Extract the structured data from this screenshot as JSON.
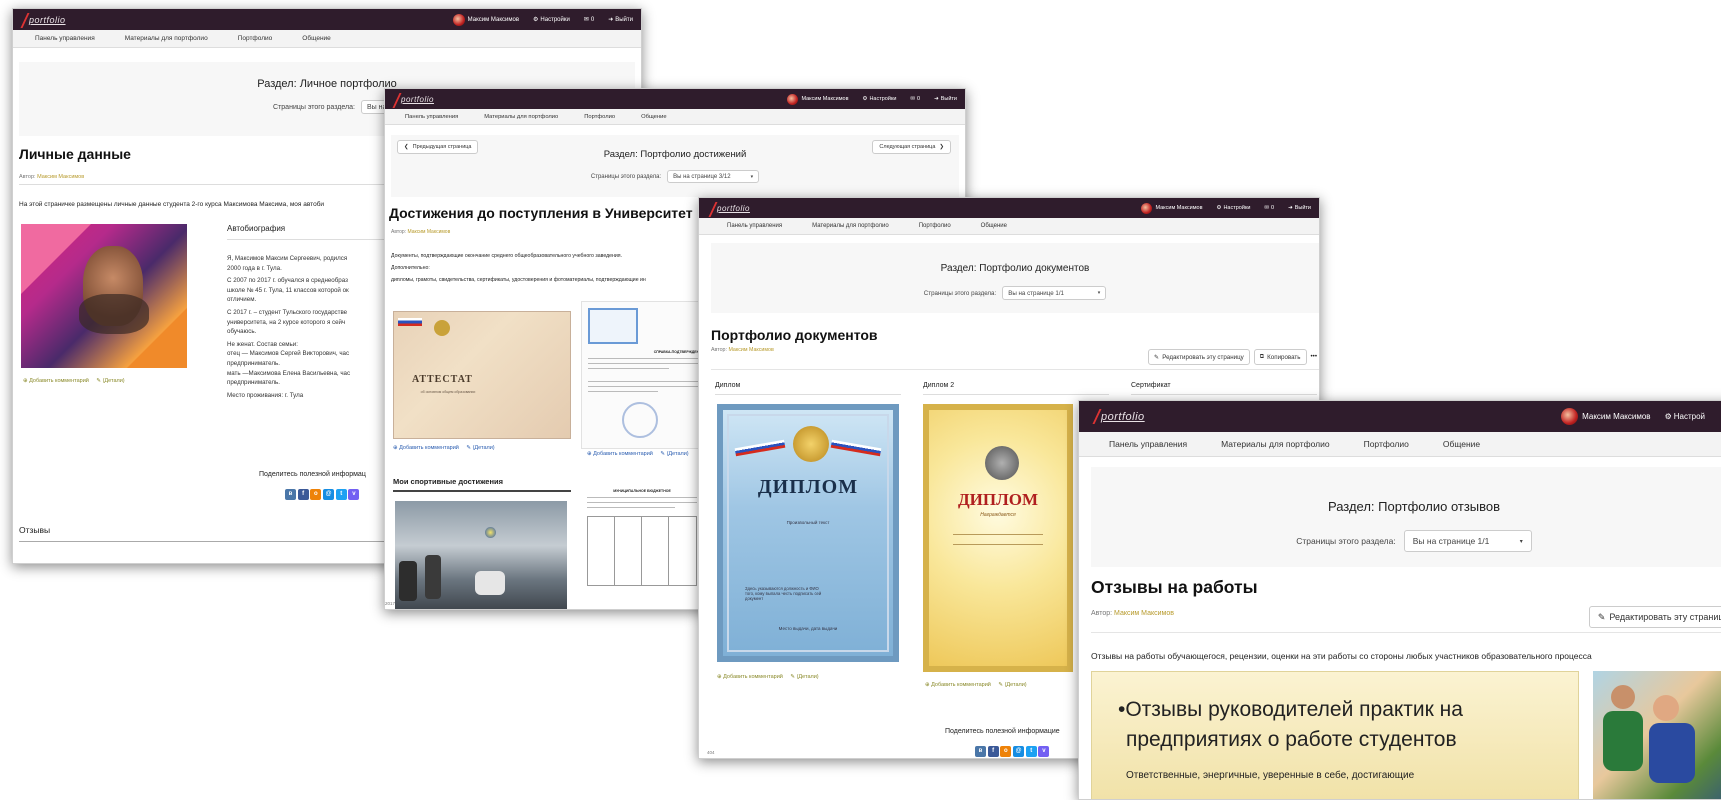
{
  "common": {
    "user_name": "Максим Максимов",
    "settings": "Настройки",
    "mail_count": "0",
    "logout": "Выйти",
    "logo_text": "portfolio",
    "menu": [
      "Панель управления",
      "Материалы для портфолио",
      "Портфолио",
      "Общение"
    ],
    "pages_label": "Страницы этого раздела:",
    "add_comment": "Добавить комментарий",
    "details": "(Детали)",
    "author_label": "Автор:",
    "share_text": "Поделитесь полезной информацией",
    "edit_page": "Редактировать эту страницу",
    "copy": "Копировать",
    "more": "•••"
  },
  "w1": {
    "section": "Раздел: Личное портфолио",
    "page_select": "Вы на страни",
    "title": "Личные данные",
    "author": "Максим Максимов",
    "intro": "На этой страничке размещены личные данные студента 2-го курса Максимова Максима, моя автоби",
    "bio_heading": "Автобиография",
    "bio_lines": [
      "Я, Максимов Максим Сергеевич, родился",
      "2000 года в г. Тула.",
      "С 2007 по 2017 г. обучался в среднеобраз",
      "школе № 45 г. Тула, 11 классов которой ок",
      "отличием.",
      "С 2017 г. – студент Тульского государстве",
      "университета, на 2 курсе которого я сейч",
      "обучаюсь.",
      "Не женат. Состав семьи:",
      "отец — Максимов Сергей Викторович, час",
      "предприниматель.",
      "мать —Максимова Елена Васильевна, час",
      "предприниматель.",
      "Место проживания: г. Тула"
    ],
    "share": "Поделитесь полезной информац",
    "reviews": "Отзывы"
  },
  "w2": {
    "prev": "Предыдущая страница",
    "next": "Следующая страница",
    "section": "Раздел: Портфолио достижений",
    "page_select": "Вы на странице 3/12",
    "title": "Достижения до поступления в Университет",
    "author": "Максим Максимов",
    "docs_line": "Документы, подтверждающие окончание среднего общеобразовательного учебного заведения.",
    "extra_label": "Дополнительно:",
    "extra_line": "дипломы, грамоты, свидетельства, сертификаты, удостоверения и фотоматериалы, подтверждающие ин",
    "attestat": "АТТЕСТАТ",
    "attestat_sub": "об основном общем образовании",
    "cert_heading": "СПРАВКА-ПОДТВЕРЖДЕНИЕ",
    "sport_heading": "Мои спортивные достижения",
    "footer_year": "2017"
  },
  "w3": {
    "section": "Раздел: Портфолио документов",
    "page_select": "Вы на странице 1/1",
    "title": "Портфолио документов",
    "author": "Максим Максимов",
    "col1": "Диплом",
    "col2": "Диплом 2",
    "col3": "Сертификат",
    "diploma_word": "ДИПЛОМ",
    "diploma_sub1": "Произвольный текст",
    "diploma_sub2": "Здесь указываются должность и ФИО того, кому выпала честь подписать сей документ",
    "diploma_sub3": "Место выдачи, дата выдачи",
    "diploma2_sub": "Награждается",
    "share": "Поделитесь полезной информацие",
    "page_num": "404"
  },
  "w4": {
    "section": "Раздел: Портфолио отзывов",
    "page_select": "Вы на странице 1/1",
    "title": "Отзывы на работы",
    "author": "Максим Максимов",
    "settings_trunc": "Настрой",
    "edit_trunc": "Редактировать эту страницу",
    "desc": "Отзывы на работы обучающегося, рецензии, оценки на эти работы со стороны любых участников образовательного процесса",
    "slide_line1": "•Отзывы руководителей практик  на",
    "slide_line2": "предприятиях о работе студентов",
    "slide_line3": "Ответственные, энергичные, уверенные в себе, достигающие"
  },
  "colors": {
    "topbar": "#2f1c2c",
    "accent_author": "#b79a2b"
  }
}
